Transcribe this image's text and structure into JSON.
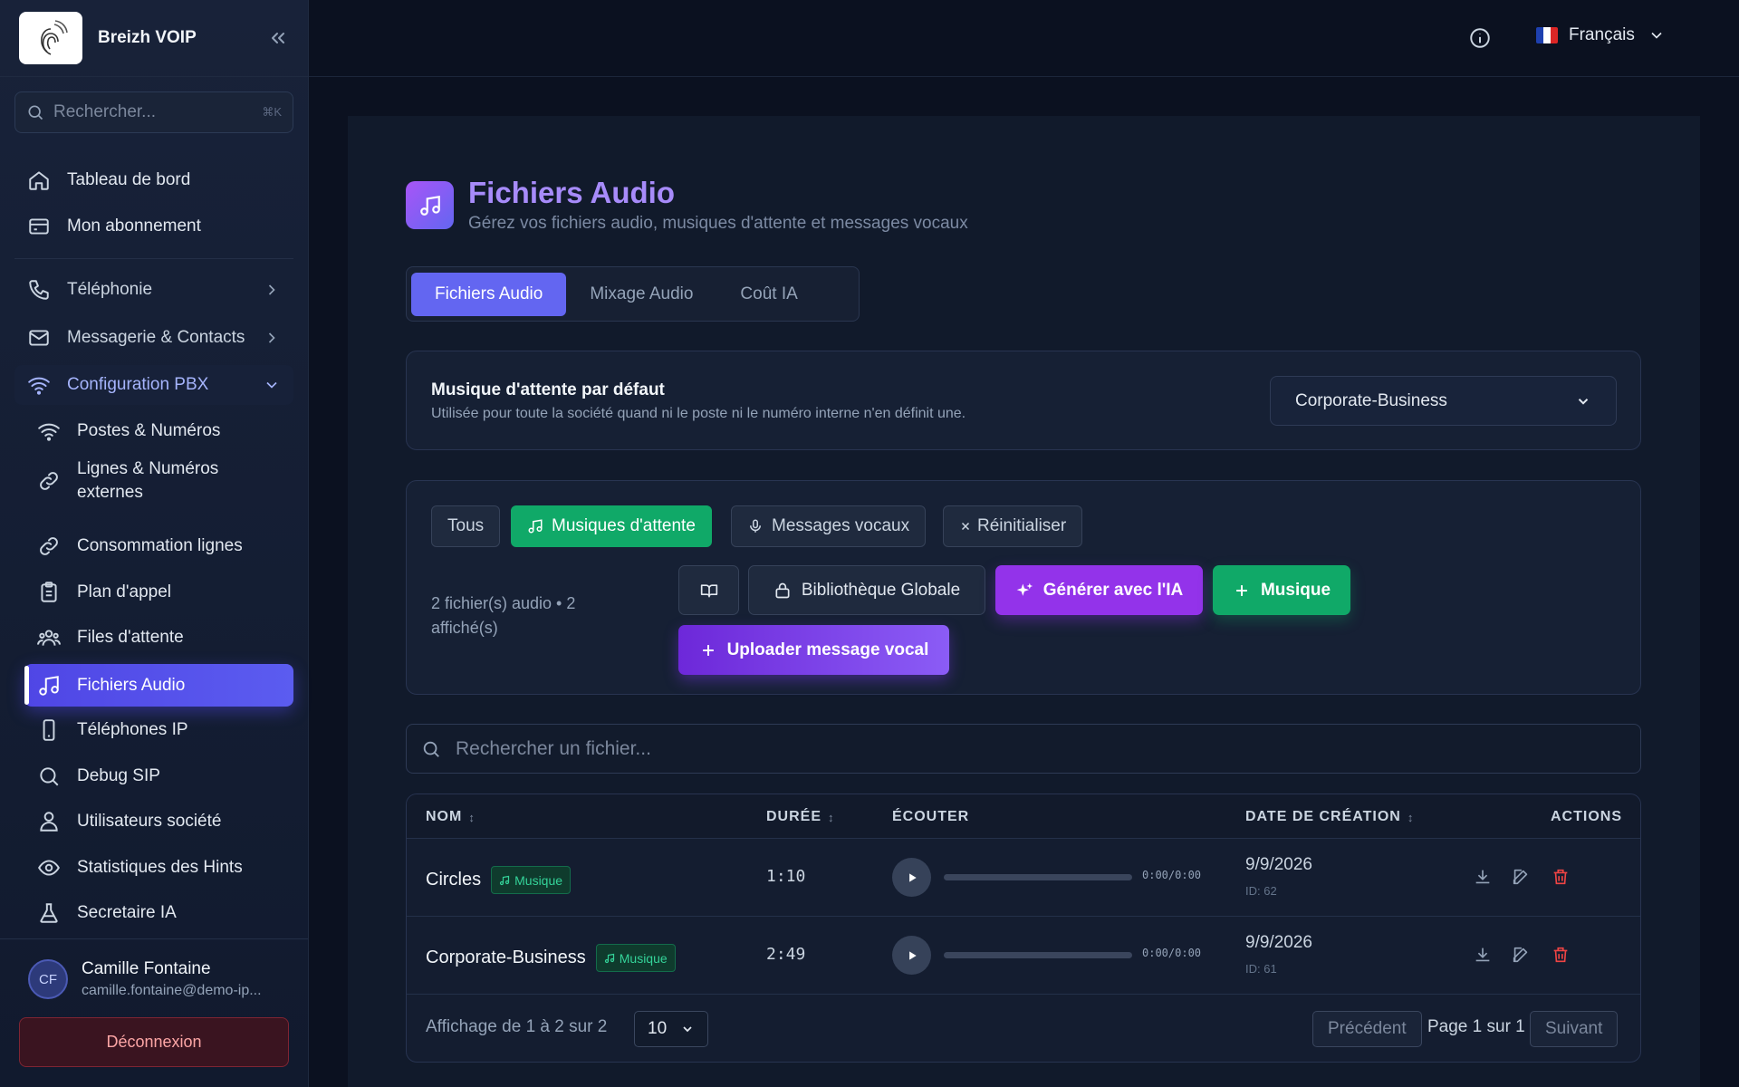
{
  "app": {
    "name": "Breizh VOIP"
  },
  "sidebar": {
    "search_placeholder": "Rechercher...",
    "search_shortcut": "⌘K",
    "items": [
      {
        "label": "Tableau de bord",
        "icon": "home-icon"
      },
      {
        "label": "Mon abonnement",
        "icon": "credit-card-icon"
      },
      {
        "label": "Téléphonie",
        "icon": "phone-icon"
      },
      {
        "label": "Messagerie & Contacts",
        "icon": "mail-icon"
      },
      {
        "label": "Configuration PBX",
        "icon": "wifi-icon"
      },
      {
        "label": "Postes & Numéros",
        "icon": "wifi-icon"
      },
      {
        "label": "Lignes & Numéros externes",
        "icon": "link-icon"
      },
      {
        "label": "Consommation lignes",
        "icon": "link-icon"
      },
      {
        "label": "Plan d'appel",
        "icon": "clipboard-icon"
      },
      {
        "label": "Files d'attente",
        "icon": "users-icon"
      },
      {
        "label": "Fichiers Audio",
        "icon": "music-icon"
      },
      {
        "label": "Téléphones IP",
        "icon": "smartphone-icon"
      },
      {
        "label": "Debug SIP",
        "icon": "search-icon"
      },
      {
        "label": "Utilisateurs société",
        "icon": "user-group-icon"
      },
      {
        "label": "Statistiques des Hints",
        "icon": "eye-icon"
      },
      {
        "label": "Secretaire IA",
        "icon": "flask-icon"
      }
    ],
    "user": {
      "initials": "CF",
      "name": "Camille Fontaine",
      "email": "camille.fontaine@demo-ip..."
    },
    "logout_label": "Déconnexion"
  },
  "topbar": {
    "language": "Français"
  },
  "page": {
    "title": "Fichiers Audio",
    "subtitle": "Gérez vos fichiers audio, musiques d'attente et messages vocaux",
    "tabs": [
      "Fichiers Audio",
      "Mixage Audio",
      "Coût IA"
    ],
    "moh": {
      "title": "Musique d'attente par défaut",
      "subtitle": "Utilisée pour toute la société quand ni le poste ni le numéro interne n'en définit une.",
      "selected": "Corporate-Business"
    },
    "filters": {
      "all": "Tous",
      "music": "Musiques d'attente",
      "voice": "Messages vocaux",
      "reset": "Réinitialiser"
    },
    "count_text": "2 fichier(s) audio • 2 affiché(s)",
    "buttons": {
      "library": "Bibliothèque Globale",
      "generate": "Générer avec l'IA",
      "music": "Musique",
      "upload": "Uploader message vocal"
    },
    "search_placeholder": "Rechercher un fichier...",
    "table": {
      "headers": {
        "name": "NOM",
        "duration": "DURÉE",
        "listen": "ÉCOUTER",
        "date": "DATE DE CRÉATION",
        "actions": "ACTIONS"
      },
      "rows": [
        {
          "name": "Circles",
          "tag": "Musique",
          "duration": "1:10",
          "time": "0:00/0:00",
          "progress": 0,
          "date": "9/9/2026",
          "id": "ID: 62"
        },
        {
          "name": "Corporate-Business",
          "tag": "Musique",
          "duration": "2:49",
          "time": "0:00/0:00",
          "progress": 0,
          "date": "9/9/2026",
          "id": "ID: 61"
        }
      ],
      "footer": {
        "showing": "Affichage de 1 à 2 sur 2",
        "per_page": "10",
        "prev": "Précédent",
        "page": "Page 1 sur 1",
        "next": "Suivant"
      }
    }
  },
  "colors": {
    "accent": "#6366f1",
    "green": "#10a968",
    "purple": "#9333ea",
    "danger": "#ef4444",
    "title": "#a78bfa"
  }
}
